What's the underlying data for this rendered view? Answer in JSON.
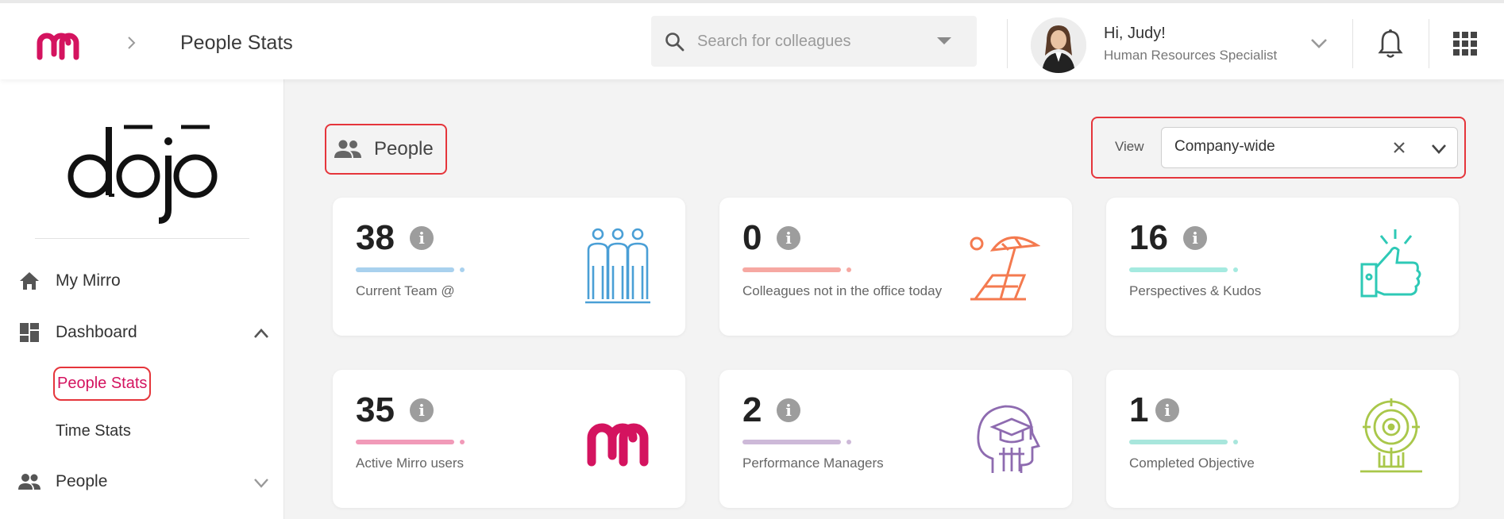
{
  "header": {
    "page_title": "People Stats",
    "search_placeholder": "Search for colleagues",
    "user": {
      "greeting": "Hi, Judy!",
      "role": "Human Resources Specialist"
    }
  },
  "sidebar": {
    "items": [
      {
        "label": "My Mirro",
        "icon": "home-icon"
      },
      {
        "label": "Dashboard",
        "icon": "dashboard-icon",
        "expanded": true
      },
      {
        "label": "People",
        "icon": "people-icon",
        "expanded": false
      }
    ],
    "dashboard_sub": [
      {
        "label": "People Stats",
        "active": true
      },
      {
        "label": "Time Stats",
        "active": false
      }
    ]
  },
  "main": {
    "section_title": "People",
    "view": {
      "label": "View",
      "value": "Company-wide"
    },
    "cards": [
      {
        "value": "38",
        "label": "Current Team @",
        "color": "#4a9fd6",
        "bar_color": "#a9d1ee",
        "icon": "team-icon"
      },
      {
        "value": "0",
        "label": "Colleagues not in the office today",
        "color": "#f47a4f",
        "bar_color": "#f6a8a2",
        "icon": "beach-umbrella-icon"
      },
      {
        "value": "16",
        "label": "Perspectives & Kudos",
        "color": "#2ec9b6",
        "bar_color": "#a5eae0",
        "icon": "thumbs-up-icon"
      },
      {
        "value": "35",
        "label": "Active Mirro users",
        "color": "#d4135f",
        "bar_color": "#f19ab8",
        "icon": "mirro-logo-icon"
      },
      {
        "value": "2",
        "label": "Performance Managers",
        "color": "#8e6bb0",
        "bar_color": "#cdb9d8",
        "icon": "graduate-head-icon"
      },
      {
        "value": "1",
        "label": "Completed Objective",
        "color": "#a9c74a",
        "bar_color": "#a8e6dc",
        "icon": "target-icon"
      }
    ]
  },
  "colors": {
    "brand": "#d4135f",
    "highlight": "#e5353b"
  }
}
